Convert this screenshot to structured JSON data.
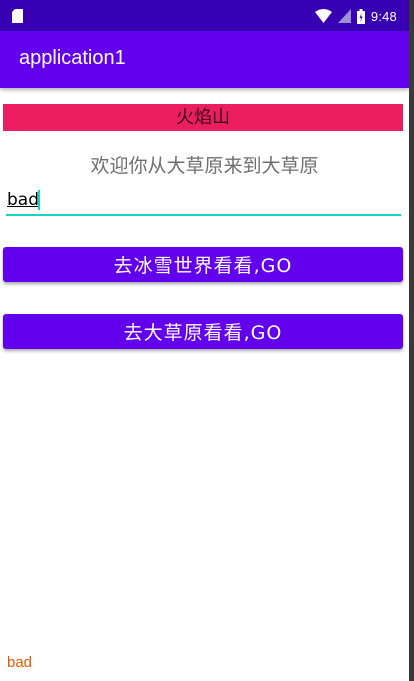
{
  "status_bar": {
    "time": "9:48",
    "icons": [
      "sim-card-icon",
      "wifi-icon",
      "cellular-signal-icon",
      "battery-icon"
    ]
  },
  "app_bar": {
    "title": "application1"
  },
  "banner": {
    "text": "火焰山"
  },
  "welcome": {
    "text": "欢迎你从大草原来到大草原"
  },
  "input": {
    "value": "bad"
  },
  "buttons": {
    "snow_world": "去冰雪世界看看,GO",
    "grassland": "去大草原看看,GO"
  },
  "bottom_text": "bad",
  "colors": {
    "status_bar": "#3700b3",
    "app_bar": "#6200ee",
    "banner": "#ec1e61",
    "accent": "#17d4c2",
    "bottom_text": "#e65c00"
  }
}
